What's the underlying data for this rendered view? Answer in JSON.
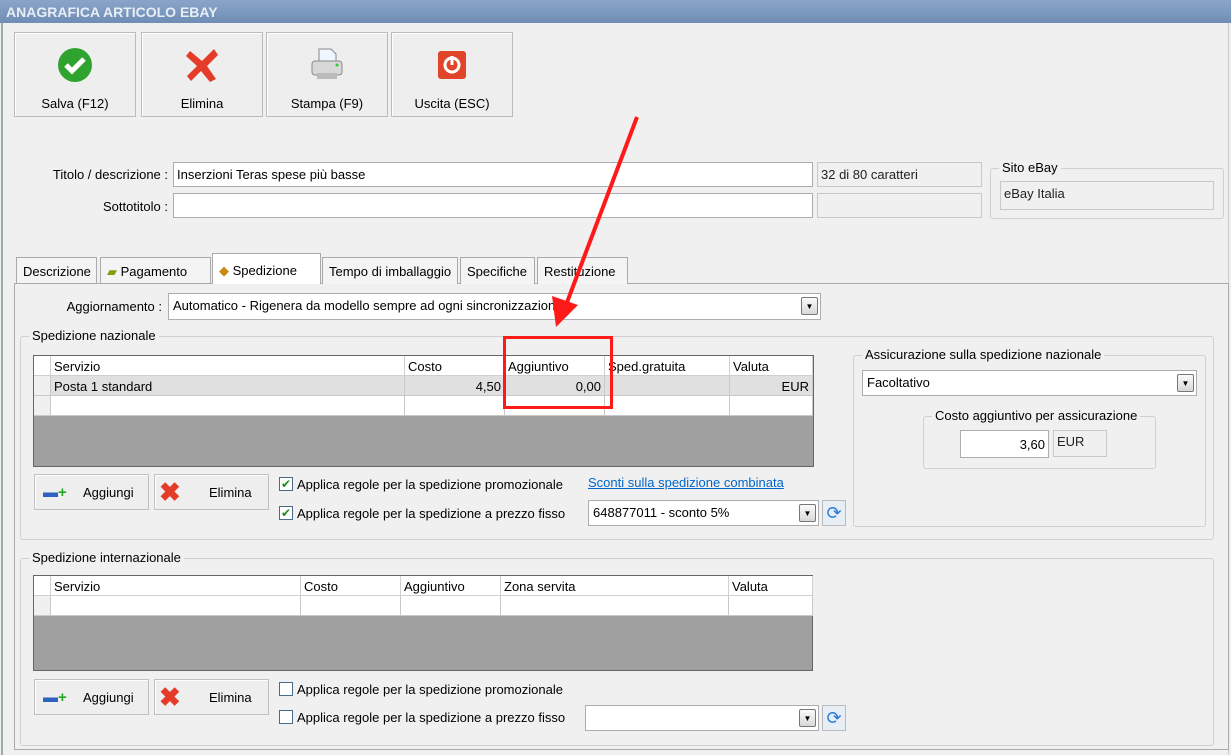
{
  "window": {
    "title": "ANAGRAFICA ARTICOLO EBAY"
  },
  "toolbar": {
    "save": "Salva (F12)",
    "delete": "Elimina",
    "print": "Stampa (F9)",
    "exit": "Uscita (ESC)"
  },
  "form": {
    "title_label": "Titolo / descrizione :",
    "title_value": "Inserzioni Teras spese più basse",
    "char_count": "32 di 80 caratteri",
    "subtitle_label": "Sottotitolo :",
    "subtitle_value": "",
    "site_group": "Sito eBay",
    "site_value": "eBay Italia"
  },
  "tabs": [
    "Descrizione",
    "Pagamento",
    "Spedizione",
    "Tempo di imballaggio",
    "Specifiche",
    "Restituzione"
  ],
  "update": {
    "label": "Aggiornamento :",
    "value": "Automatico - Rigenera da modello sempre ad ogni sincronizzazione"
  },
  "national": {
    "group": "Spedizione nazionale",
    "columns": [
      "Servizio",
      "Costo",
      "Aggiuntivo",
      "Sped.gratuita",
      "Valuta"
    ],
    "rows": [
      [
        "Posta 1 standard",
        "4,50",
        "0,00",
        "",
        "EUR"
      ]
    ],
    "add": "Aggiungi",
    "delete": "Elimina",
    "promo_rule": "Applica regole per la spedizione promozionale",
    "promo_checked": true,
    "fixed_rule": "Applica regole per la spedizione a prezzo fisso",
    "fixed_checked": true,
    "combined_link": "Sconti sulla spedizione combinata",
    "discount_value": "648877011 - sconto 5%"
  },
  "insurance": {
    "group": "Assicurazione sulla spedizione nazionale",
    "value": "Facoltativo",
    "cost_group": "Costo aggiuntivo per assicurazione",
    "cost": "3,60",
    "currency": "EUR"
  },
  "international": {
    "group": "Spedizione internazionale",
    "columns": [
      "Servizio",
      "Costo",
      "Aggiuntivo",
      "Zona servita",
      "Valuta"
    ],
    "add": "Aggiungi",
    "delete": "Elimina",
    "promo_rule": "Applica regole per la spedizione promozionale",
    "promo_checked": false,
    "fixed_rule": "Applica regole per la spedizione a prezzo fisso",
    "fixed_checked": false,
    "discount_value": ""
  },
  "colors": {
    "annotation": "#ff1a1a",
    "titlebar": "#7793bb"
  }
}
